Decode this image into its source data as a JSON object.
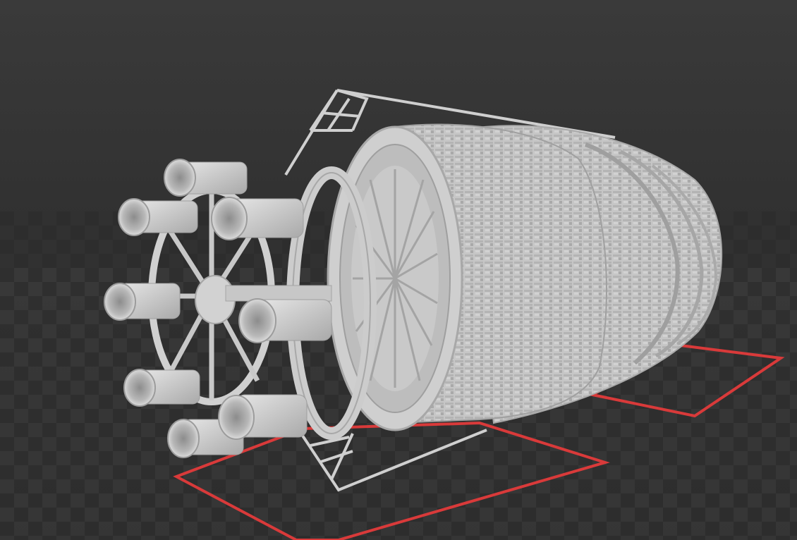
{
  "viewer": {
    "model_name": "spaceship-hull-model",
    "colors": {
      "background_top": "#3a3a3a",
      "background_bottom": "#262626",
      "grid_dark": "#2e2e2e",
      "grid_light": "#3d3d3d",
      "plate_outline": "#d93a3a",
      "model": "#c8c8c8",
      "model_shadow": "#9a9a9a",
      "model_highlight": "#e4e4e4"
    }
  }
}
